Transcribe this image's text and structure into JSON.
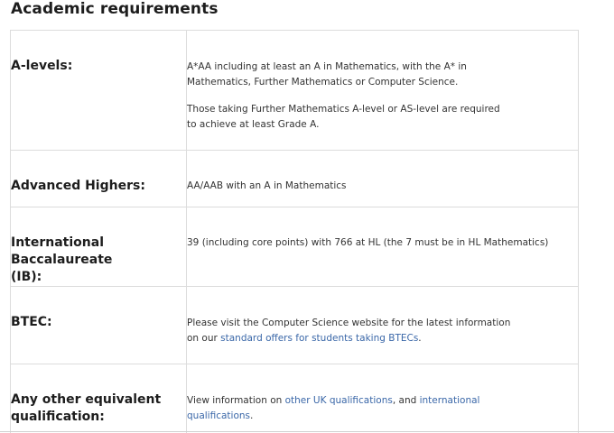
{
  "heading": "Academic requirements",
  "rows": [
    {
      "label": "A-levels:",
      "value_p1_line1": "A*AA including at least an A in Mathematics, with the A* in",
      "value_p1_line2": "Mathematics, Further Mathematics or Computer Science.",
      "value_p2_line1": "Those taking Further Mathematics A-level or AS-level are required",
      "value_p2_line2": "to achieve at least Grade A."
    },
    {
      "label": "Advanced Highers:",
      "value": "AA/AAB with an A in Mathematics"
    },
    {
      "label_line1": "International Baccalaureate",
      "label_line2": "(IB):",
      "value": "39 (including core points) with 766 at HL (the 7 must be in HL Mathematics)"
    },
    {
      "label": "BTEC:",
      "value_line1": "Please visit the Computer Science website for the latest information",
      "value_prefix": "on our ",
      "value_link": "standard offers for students taking BTECs",
      "value_suffix": "."
    },
    {
      "label_line1": "Any other equivalent",
      "label_line2": "qualification:",
      "value_prefix": "View information on ",
      "value_link1": "other UK qualifications",
      "value_mid": ", and ",
      "value_link2a": "international",
      "value_link2b": "qualifications",
      "value_suffix": "."
    }
  ],
  "colors": {
    "link": "#3a67a8",
    "border": "#dcdcdc",
    "text": "#333333"
  }
}
